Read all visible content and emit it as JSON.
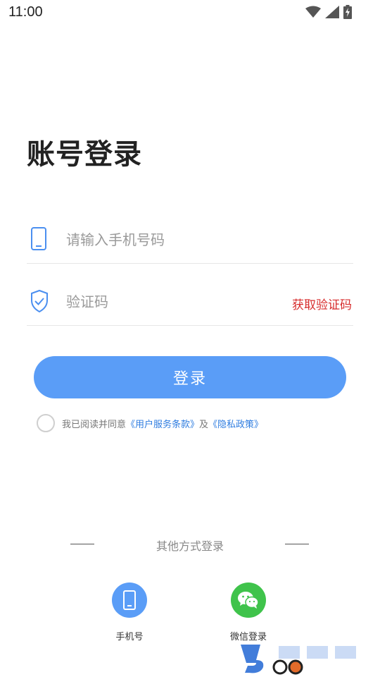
{
  "status_bar": {
    "time": "11:00"
  },
  "title": "账号登录",
  "phone_field": {
    "placeholder": "请输入手机号码"
  },
  "code_field": {
    "placeholder": "验证码",
    "get_code_label": "获取验证码"
  },
  "login_button_label": "登录",
  "agreement": {
    "prefix": "我已阅读并同意",
    "terms_link": "《用户服务条款》",
    "conjunction": "及",
    "privacy_link": "《隐私政策》"
  },
  "other_login": {
    "label": "其他方式登录",
    "options": [
      {
        "label": "手机号",
        "icon": "phone-icon"
      },
      {
        "label": "微信登录",
        "icon": "wechat-icon"
      }
    ]
  },
  "colors": {
    "accent": "#5a9df7",
    "code_link": "#d72c2c",
    "link": "#2f7de0",
    "wechat": "#3fc34b"
  }
}
